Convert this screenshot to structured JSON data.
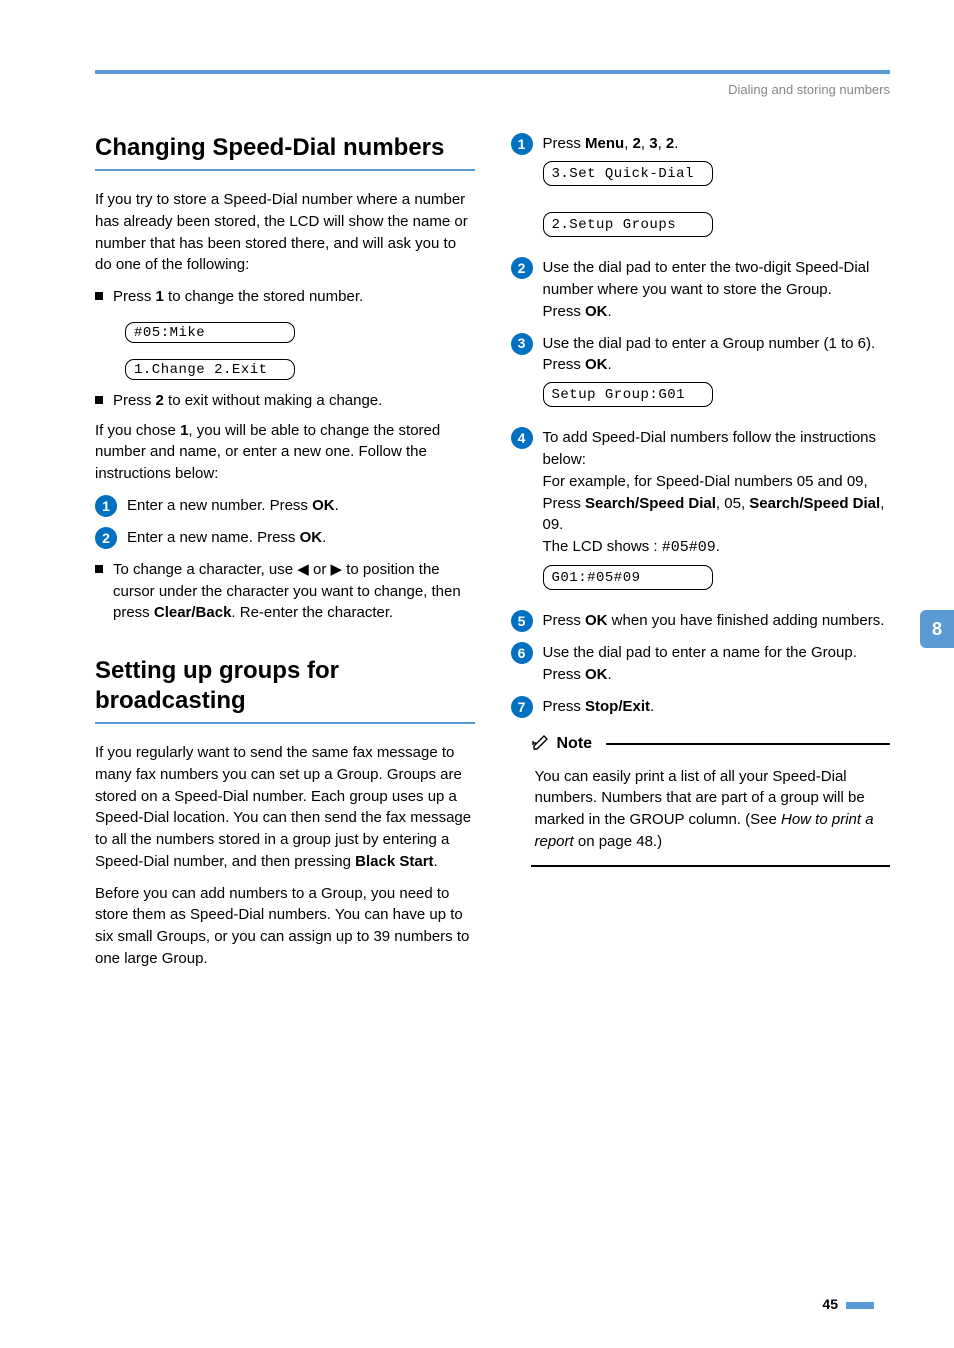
{
  "header": {
    "breadcrumb": "Dialing and storing numbers"
  },
  "left": {
    "section1": {
      "title": "Changing Speed-Dial numbers",
      "intro": "If you try to store a Speed-Dial number where a number has already been stored, the LCD will show the name or number that has been stored there, and will ask you to do one of the following:",
      "bullet1_pre": "Press ",
      "bullet1_bold": "1",
      "bullet1_post": " to change the stored number.",
      "lcd1": "#05:Mike",
      "lcd2": "1.Change 2.Exit",
      "bullet2_pre": "Press ",
      "bullet2_bold": "2",
      "bullet2_post": " to exit without making a change.",
      "chose_pre": "If you chose ",
      "chose_bold": "1",
      "chose_post": ", you will be able to change the stored number and name, or enter a new one. Follow the instructions below:",
      "step1_pre": "Enter a new number. Press ",
      "step1_bold": "OK",
      "step1_post": ".",
      "step2_pre": "Enter a new name. Press ",
      "step2_bold": "OK",
      "step2_post": ".",
      "bullet3_a": "To change a character, use ",
      "bullet3_b": " or ",
      "bullet3_c": " to position the cursor under the character you want to change, then press ",
      "bullet3_bold": "Clear/Back",
      "bullet3_d": ". Re-enter the character."
    },
    "section2": {
      "title": "Setting up groups for broadcasting",
      "para1_a": "If you regularly want to send the same fax message to many fax numbers you can set up a Group. Groups are stored on a Speed-Dial number. Each group uses up a Speed-Dial location. You can then send the fax message to all the numbers stored in a group just by entering a Speed-Dial number, and then pressing ",
      "para1_bold": "Black Start",
      "para1_b": ".",
      "para2": "Before you can add numbers to a Group, you need to store them as Speed-Dial numbers. You can have up to six small Groups, or you can assign up to 39 numbers to one large Group."
    }
  },
  "right": {
    "step1_pre": "Press ",
    "step1_b1": "Menu",
    "step1_s1": ", ",
    "step1_b2": "2",
    "step1_s2": ", ",
    "step1_b3": "3",
    "step1_s3": ", ",
    "step1_b4": "2",
    "step1_post": ".",
    "lcd1": "3.Set Quick-Dial",
    "lcd2": "2.Setup Groups",
    "step2_a": "Use the dial pad to enter the two-digit Speed-Dial number where you want to store the Group.",
    "step2_b_pre": "Press ",
    "step2_b_bold": "OK",
    "step2_b_post": ".",
    "step3_a": "Use the dial pad to enter a Group number (1 to 6).",
    "step3_b_pre": "Press ",
    "step3_b_bold": "OK",
    "step3_b_post": ".",
    "lcd3": "Setup Group:G01",
    "step4_a": "To add Speed-Dial numbers follow the instructions below:",
    "step4_b_pre": "For example, for Speed-Dial numbers 05 and 09, Press ",
    "step4_b_bold1": "Search/Speed Dial",
    "step4_b_mid1": ", 05, ",
    "step4_b_bold2": "Search/Speed Dial",
    "step4_b_mid2": ", 09.",
    "step4_c_pre": "The LCD shows : ",
    "step4_c_mono": "#05#09",
    "step4_c_post": ".",
    "lcd4": "G01:#05#09",
    "step5_pre": "Press ",
    "step5_bold": "OK",
    "step5_post": " when you have finished adding numbers.",
    "step6_a": "Use the dial pad to enter a name for the Group.",
    "step6_b_pre": "Press ",
    "step6_b_bold": "OK",
    "step6_b_post": ".",
    "step7_pre": "Press ",
    "step7_bold": "Stop/Exit",
    "step7_post": ".",
    "note_label": "Note",
    "note_body_a": "You can easily print a list of all your Speed-Dial numbers. Numbers that are part of a group will be marked in the GROUP column. (See ",
    "note_body_italic": "How to print a report",
    "note_body_b": " on page 48.)"
  },
  "sidetab": "8",
  "pagenum": "45",
  "arrows": {
    "left": "◀",
    "right": "▶"
  }
}
